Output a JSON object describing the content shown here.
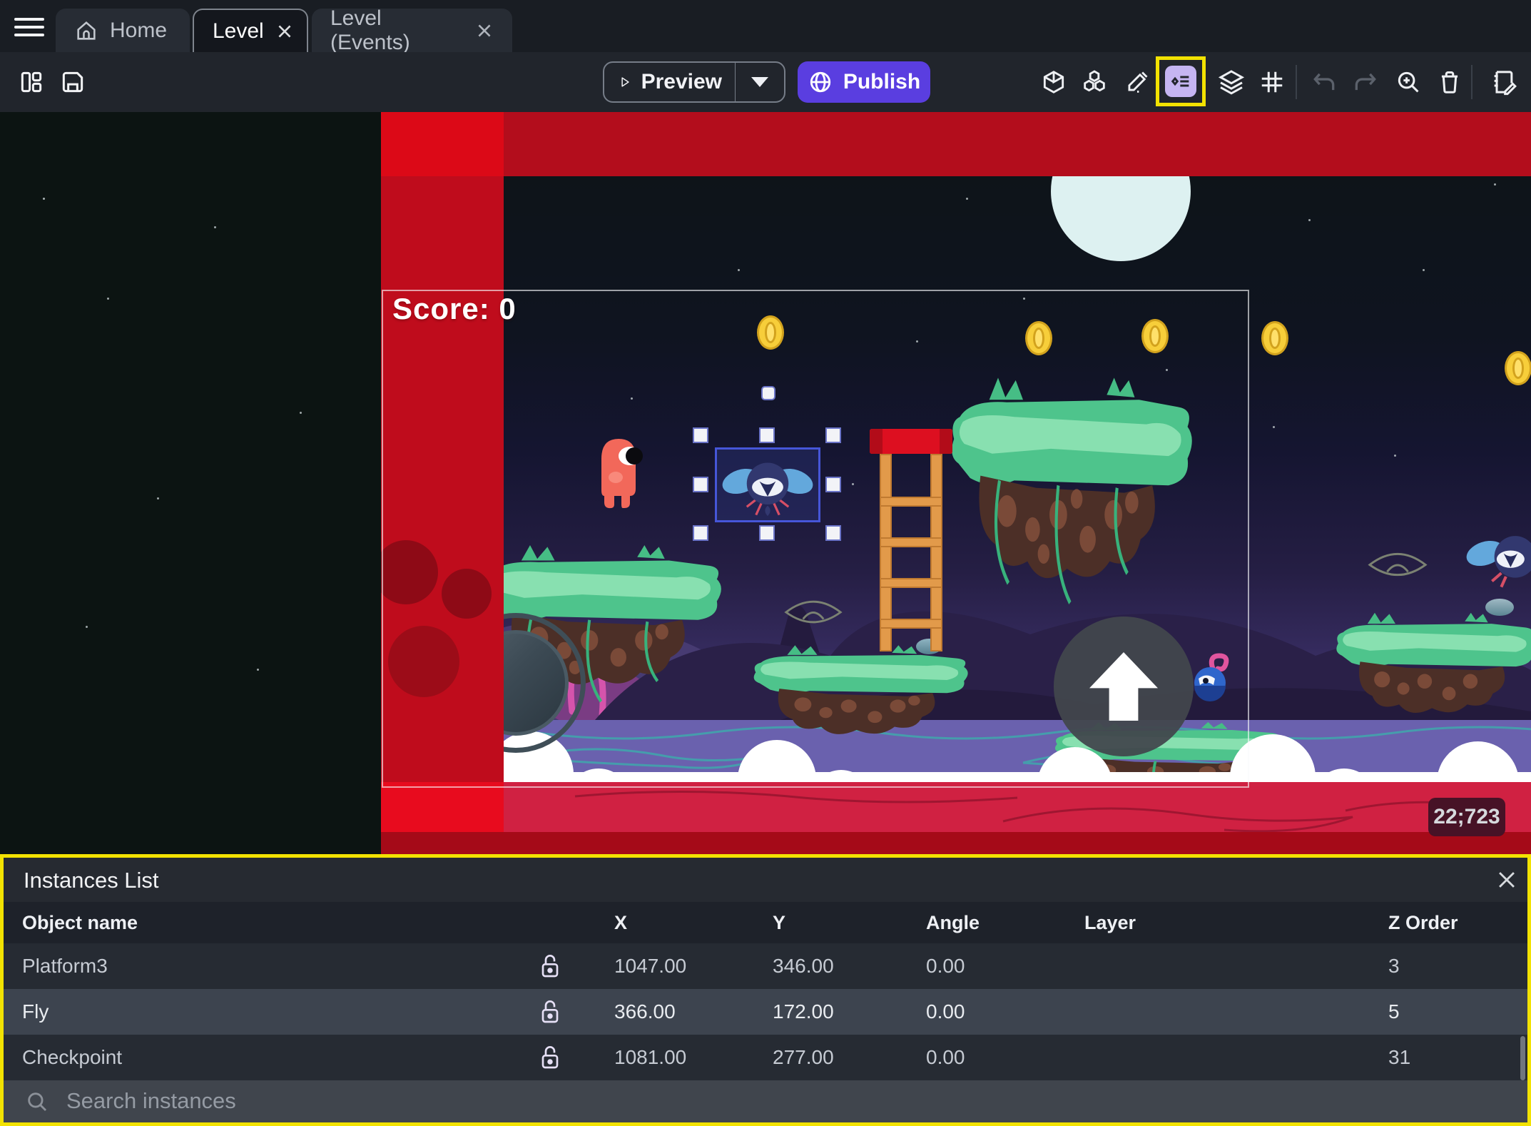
{
  "tabs": {
    "home": "Home",
    "level": "Level",
    "events": "Level (Events)"
  },
  "toolbar": {
    "preview_label": "Preview",
    "publish_label": "Publish"
  },
  "canvas": {
    "score_label": "Score: 0",
    "coordinates_badge": "22;723"
  },
  "panel": {
    "title": "Instances List",
    "columns": [
      "Object name",
      "X",
      "Y",
      "Angle",
      "Layer",
      "Z Order"
    ],
    "rows": [
      {
        "name": "Platform3",
        "x": "1047.00",
        "y": "346.00",
        "angle": "0.00",
        "layer": "",
        "z": "3"
      },
      {
        "name": "Fly",
        "x": "366.00",
        "y": "172.00",
        "angle": "0.00",
        "layer": "",
        "z": "5"
      },
      {
        "name": "Checkpoint",
        "x": "1081.00",
        "y": "277.00",
        "angle": "0.00",
        "layer": "",
        "z": "31"
      }
    ],
    "search_placeholder": "Search instances"
  },
  "colors": {
    "accent_purple": "#5a3ee0",
    "annotation_yellow": "#f2e202",
    "selection_blue": "#4656d8",
    "red_band": "#bf0c1c",
    "panel_bg": "#262a31"
  }
}
